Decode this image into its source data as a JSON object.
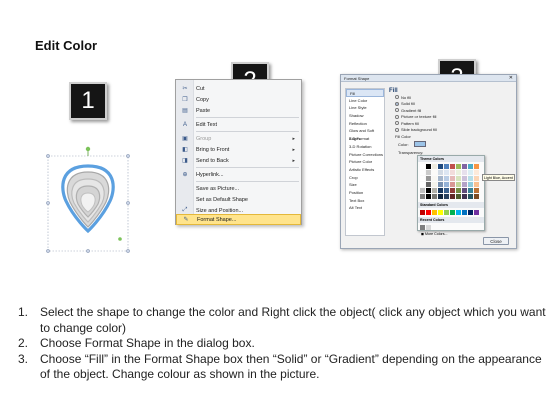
{
  "title": "Edit Color",
  "badges": [
    "1",
    "2",
    "3"
  ],
  "context_menu": {
    "items": [
      {
        "label": "Cut",
        "icon": "scissors-icon",
        "enabled": true
      },
      {
        "label": "Copy",
        "icon": "copy-icon",
        "enabled": true
      },
      {
        "label": "Paste",
        "icon": "paste-icon",
        "enabled": true
      },
      {
        "label": "Edit Text",
        "icon": "edit-text-icon",
        "enabled": true
      },
      {
        "label": "Group",
        "icon": "group-icon",
        "enabled": false,
        "submenu": true
      },
      {
        "label": "Bring to Front",
        "icon": "bring-front-icon",
        "enabled": true,
        "submenu": true
      },
      {
        "label": "Send to Back",
        "icon": "send-back-icon",
        "enabled": true,
        "submenu": true
      },
      {
        "label": "Hyperlink...",
        "icon": "hyperlink-icon",
        "enabled": true
      },
      {
        "label": "Save as Picture...",
        "icon": "",
        "enabled": true
      },
      {
        "label": "Set as Default Shape",
        "icon": "",
        "enabled": true
      },
      {
        "label": "Size and Position...",
        "icon": "size-icon",
        "enabled": true
      },
      {
        "label": "Format Shape...",
        "icon": "format-icon",
        "enabled": true,
        "highlighted": true
      }
    ]
  },
  "dialog": {
    "title": "Format Shape",
    "sidebar": [
      "Fill",
      "Line Color",
      "Line Style",
      "Shadow",
      "Reflection",
      "Glow and Soft Edges",
      "3-D Format",
      "3-D Rotation",
      "Picture Corrections",
      "Picture Color",
      "Artistic Effects",
      "Crop",
      "Size",
      "Position",
      "Text Box",
      "Alt Text"
    ],
    "fill_heading": "Fill",
    "fill_options": [
      "No fill",
      "Solid fill",
      "Gradient fill",
      "Picture or texture fill",
      "Pattern fill",
      "Slide background fill"
    ],
    "fill_color_label": "Fill Color",
    "color_label": "Color:",
    "transparency_label": "Transparency:",
    "close_label": "Close",
    "palette": {
      "theme_label": "Theme Colors",
      "standard_label": "Standard Colors",
      "recent_label": "Recent Colors",
      "more_label": "More Colors...",
      "tooltip": "Light Blue, Accent 1"
    }
  },
  "steps": [
    "Select the shape to change the color and Right click the object( click any object which you want to change color)",
    "Choose Format Shape in the dialog box.",
    "Choose “Fill” in the Format Shape box then “Solid” or “Gradient” depending on the appearance of the object. Change colour as shown in the picture."
  ]
}
